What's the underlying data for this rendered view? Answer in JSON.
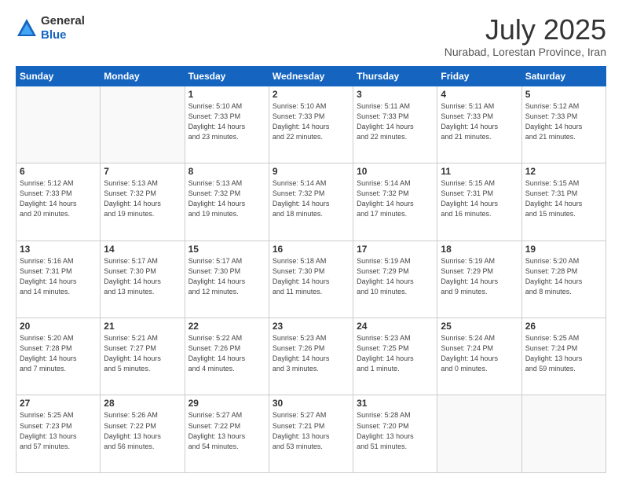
{
  "header": {
    "logo": {
      "line1": "General",
      "line2": "Blue"
    },
    "title": "July 2025",
    "subtitle": "Nurabad, Lorestan Province, Iran"
  },
  "weekdays": [
    "Sunday",
    "Monday",
    "Tuesday",
    "Wednesday",
    "Thursday",
    "Friday",
    "Saturday"
  ],
  "weeks": [
    [
      {
        "day": "",
        "info": ""
      },
      {
        "day": "",
        "info": ""
      },
      {
        "day": "1",
        "info": "Sunrise: 5:10 AM\nSunset: 7:33 PM\nDaylight: 14 hours\nand 23 minutes."
      },
      {
        "day": "2",
        "info": "Sunrise: 5:10 AM\nSunset: 7:33 PM\nDaylight: 14 hours\nand 22 minutes."
      },
      {
        "day": "3",
        "info": "Sunrise: 5:11 AM\nSunset: 7:33 PM\nDaylight: 14 hours\nand 22 minutes."
      },
      {
        "day": "4",
        "info": "Sunrise: 5:11 AM\nSunset: 7:33 PM\nDaylight: 14 hours\nand 21 minutes."
      },
      {
        "day": "5",
        "info": "Sunrise: 5:12 AM\nSunset: 7:33 PM\nDaylight: 14 hours\nand 21 minutes."
      }
    ],
    [
      {
        "day": "6",
        "info": "Sunrise: 5:12 AM\nSunset: 7:33 PM\nDaylight: 14 hours\nand 20 minutes."
      },
      {
        "day": "7",
        "info": "Sunrise: 5:13 AM\nSunset: 7:32 PM\nDaylight: 14 hours\nand 19 minutes."
      },
      {
        "day": "8",
        "info": "Sunrise: 5:13 AM\nSunset: 7:32 PM\nDaylight: 14 hours\nand 19 minutes."
      },
      {
        "day": "9",
        "info": "Sunrise: 5:14 AM\nSunset: 7:32 PM\nDaylight: 14 hours\nand 18 minutes."
      },
      {
        "day": "10",
        "info": "Sunrise: 5:14 AM\nSunset: 7:32 PM\nDaylight: 14 hours\nand 17 minutes."
      },
      {
        "day": "11",
        "info": "Sunrise: 5:15 AM\nSunset: 7:31 PM\nDaylight: 14 hours\nand 16 minutes."
      },
      {
        "day": "12",
        "info": "Sunrise: 5:15 AM\nSunset: 7:31 PM\nDaylight: 14 hours\nand 15 minutes."
      }
    ],
    [
      {
        "day": "13",
        "info": "Sunrise: 5:16 AM\nSunset: 7:31 PM\nDaylight: 14 hours\nand 14 minutes."
      },
      {
        "day": "14",
        "info": "Sunrise: 5:17 AM\nSunset: 7:30 PM\nDaylight: 14 hours\nand 13 minutes."
      },
      {
        "day": "15",
        "info": "Sunrise: 5:17 AM\nSunset: 7:30 PM\nDaylight: 14 hours\nand 12 minutes."
      },
      {
        "day": "16",
        "info": "Sunrise: 5:18 AM\nSunset: 7:30 PM\nDaylight: 14 hours\nand 11 minutes."
      },
      {
        "day": "17",
        "info": "Sunrise: 5:19 AM\nSunset: 7:29 PM\nDaylight: 14 hours\nand 10 minutes."
      },
      {
        "day": "18",
        "info": "Sunrise: 5:19 AM\nSunset: 7:29 PM\nDaylight: 14 hours\nand 9 minutes."
      },
      {
        "day": "19",
        "info": "Sunrise: 5:20 AM\nSunset: 7:28 PM\nDaylight: 14 hours\nand 8 minutes."
      }
    ],
    [
      {
        "day": "20",
        "info": "Sunrise: 5:20 AM\nSunset: 7:28 PM\nDaylight: 14 hours\nand 7 minutes."
      },
      {
        "day": "21",
        "info": "Sunrise: 5:21 AM\nSunset: 7:27 PM\nDaylight: 14 hours\nand 5 minutes."
      },
      {
        "day": "22",
        "info": "Sunrise: 5:22 AM\nSunset: 7:26 PM\nDaylight: 14 hours\nand 4 minutes."
      },
      {
        "day": "23",
        "info": "Sunrise: 5:23 AM\nSunset: 7:26 PM\nDaylight: 14 hours\nand 3 minutes."
      },
      {
        "day": "24",
        "info": "Sunrise: 5:23 AM\nSunset: 7:25 PM\nDaylight: 14 hours\nand 1 minute."
      },
      {
        "day": "25",
        "info": "Sunrise: 5:24 AM\nSunset: 7:24 PM\nDaylight: 14 hours\nand 0 minutes."
      },
      {
        "day": "26",
        "info": "Sunrise: 5:25 AM\nSunset: 7:24 PM\nDaylight: 13 hours\nand 59 minutes."
      }
    ],
    [
      {
        "day": "27",
        "info": "Sunrise: 5:25 AM\nSunset: 7:23 PM\nDaylight: 13 hours\nand 57 minutes."
      },
      {
        "day": "28",
        "info": "Sunrise: 5:26 AM\nSunset: 7:22 PM\nDaylight: 13 hours\nand 56 minutes."
      },
      {
        "day": "29",
        "info": "Sunrise: 5:27 AM\nSunset: 7:22 PM\nDaylight: 13 hours\nand 54 minutes."
      },
      {
        "day": "30",
        "info": "Sunrise: 5:27 AM\nSunset: 7:21 PM\nDaylight: 13 hours\nand 53 minutes."
      },
      {
        "day": "31",
        "info": "Sunrise: 5:28 AM\nSunset: 7:20 PM\nDaylight: 13 hours\nand 51 minutes."
      },
      {
        "day": "",
        "info": ""
      },
      {
        "day": "",
        "info": ""
      }
    ]
  ]
}
